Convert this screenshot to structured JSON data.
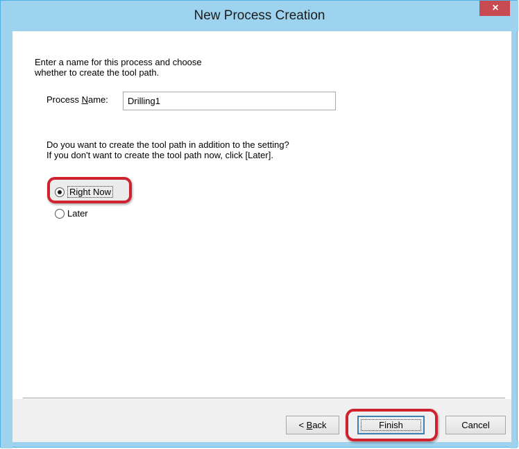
{
  "window": {
    "title": "New Process Creation",
    "close_glyph": "×"
  },
  "intro": {
    "text": "Enter a name for this process and choose\nwhether to create the tool path."
  },
  "process_name": {
    "label_prefix": "Process ",
    "label_accel": "N",
    "label_suffix": "ame:",
    "value": "Drilling1"
  },
  "question": {
    "text": "Do you want to create the tool path in addition to the setting?\nIf you don't want to create the tool path now, click [Later]."
  },
  "options": {
    "right_now": "Right Now",
    "later": "Later",
    "selected": "right_now"
  },
  "buttons": {
    "back_prefix": "< ",
    "back_accel": "B",
    "back_suffix": "ack",
    "finish": "Finish",
    "cancel": "Cancel"
  },
  "colors": {
    "frame": "#9dd3ee",
    "close_button": "#c74b50",
    "highlight": "#d0212f"
  }
}
